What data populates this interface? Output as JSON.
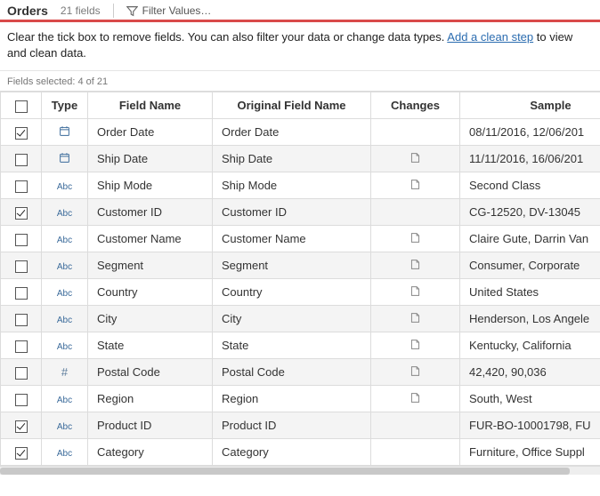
{
  "header": {
    "title": "Orders",
    "field_count_label": "21 fields",
    "filter_label": "Filter Values…"
  },
  "info": {
    "pre": "Clear the tick box to remove fields. You can also filter your data or change data types. ",
    "link": "Add a clean step",
    "post": " to view and clean data."
  },
  "meta": {
    "selected_label": "Fields selected: 4 of 21"
  },
  "columns": {
    "type": "Type",
    "field_name": "Field Name",
    "original_field_name": "Original Field Name",
    "changes": "Changes",
    "sample": "Sample"
  },
  "rows": [
    {
      "checked": true,
      "type": "date",
      "field_name": "Order Date",
      "original_name": "Order Date",
      "changed": false,
      "sample": "08/11/2016, 12/06/201"
    },
    {
      "checked": false,
      "type": "date",
      "field_name": "Ship Date",
      "original_name": "Ship Date",
      "changed": true,
      "sample": "11/11/2016, 16/06/201"
    },
    {
      "checked": false,
      "type": "abc",
      "field_name": "Ship Mode",
      "original_name": "Ship Mode",
      "changed": true,
      "sample": "Second Class"
    },
    {
      "checked": true,
      "type": "abc",
      "field_name": "Customer ID",
      "original_name": "Customer ID",
      "changed": false,
      "sample": "CG-12520, DV-13045"
    },
    {
      "checked": false,
      "type": "abc",
      "field_name": "Customer Name",
      "original_name": "Customer Name",
      "changed": true,
      "sample": "Claire Gute, Darrin Van"
    },
    {
      "checked": false,
      "type": "abc",
      "field_name": "Segment",
      "original_name": "Segment",
      "changed": true,
      "sample": "Consumer, Corporate"
    },
    {
      "checked": false,
      "type": "abc",
      "field_name": "Country",
      "original_name": "Country",
      "changed": true,
      "sample": "United States"
    },
    {
      "checked": false,
      "type": "abc",
      "field_name": "City",
      "original_name": "City",
      "changed": true,
      "sample": "Henderson, Los Angele"
    },
    {
      "checked": false,
      "type": "abc",
      "field_name": "State",
      "original_name": "State",
      "changed": true,
      "sample": "Kentucky, California"
    },
    {
      "checked": false,
      "type": "num",
      "field_name": "Postal Code",
      "original_name": "Postal Code",
      "changed": true,
      "sample": "42,420, 90,036"
    },
    {
      "checked": false,
      "type": "abc",
      "field_name": "Region",
      "original_name": "Region",
      "changed": true,
      "sample": "South, West"
    },
    {
      "checked": true,
      "type": "abc",
      "field_name": "Product ID",
      "original_name": "Product ID",
      "changed": false,
      "sample": "FUR-BO-10001798, FU"
    },
    {
      "checked": true,
      "type": "abc",
      "field_name": "Category",
      "original_name": "Category",
      "changed": false,
      "sample": "Furniture, Office Suppl"
    }
  ],
  "icons": {
    "abc_label": "Abc",
    "num_label": "#"
  }
}
